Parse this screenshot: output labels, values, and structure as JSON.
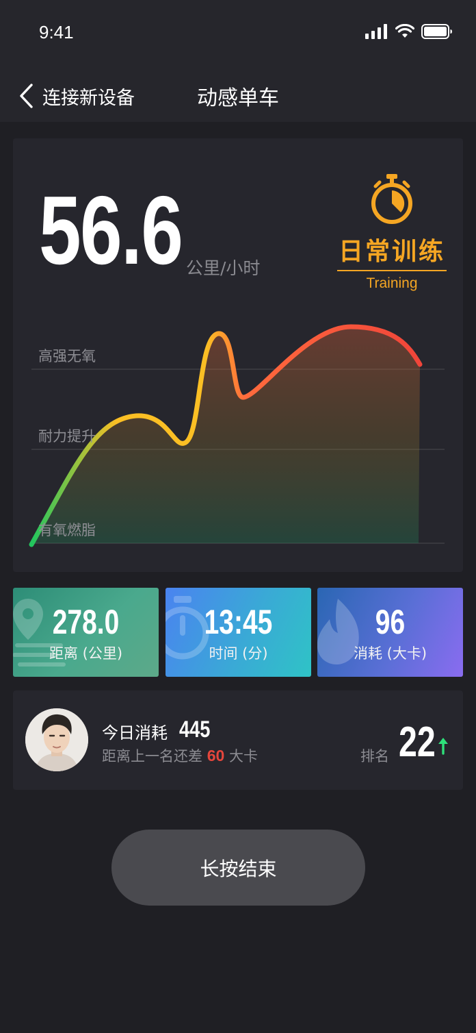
{
  "status_bar": {
    "time": "9:41"
  },
  "nav": {
    "back_label": "连接新设备",
    "title": "动感单车"
  },
  "speed": {
    "value": "56.6",
    "unit": "公里/小时"
  },
  "mode": {
    "title": "日常训练",
    "subtitle": "Training"
  },
  "zones": {
    "high": "高强无氧",
    "endurance": "耐力提升",
    "aerobic": "有氧燃脂"
  },
  "colors": {
    "accent": "#f5a623",
    "curve_start": "#22c55e",
    "curve_mid": "#fbbf24",
    "curve_end": "#f0453a",
    "rank_up": "#2ee07a",
    "gap_highlight": "#e5463c"
  },
  "stats": {
    "distance": {
      "value": "278.0",
      "label": "距离 (公里)",
      "icon": "location-pin-icon"
    },
    "time": {
      "value": "13:45",
      "label": "时间 (分)",
      "icon": "stopwatch-icon"
    },
    "calories": {
      "value": "96",
      "label": "消耗 (大卡)",
      "icon": "flame-icon"
    }
  },
  "ranking": {
    "today_label": "今日消耗",
    "today_value": "445",
    "gap_prefix": "距离上一名还差",
    "gap_value": "60",
    "gap_unit": "大卡",
    "rank_label": "排名",
    "rank_value": "22"
  },
  "actions": {
    "end_label": "长按结束"
  }
}
